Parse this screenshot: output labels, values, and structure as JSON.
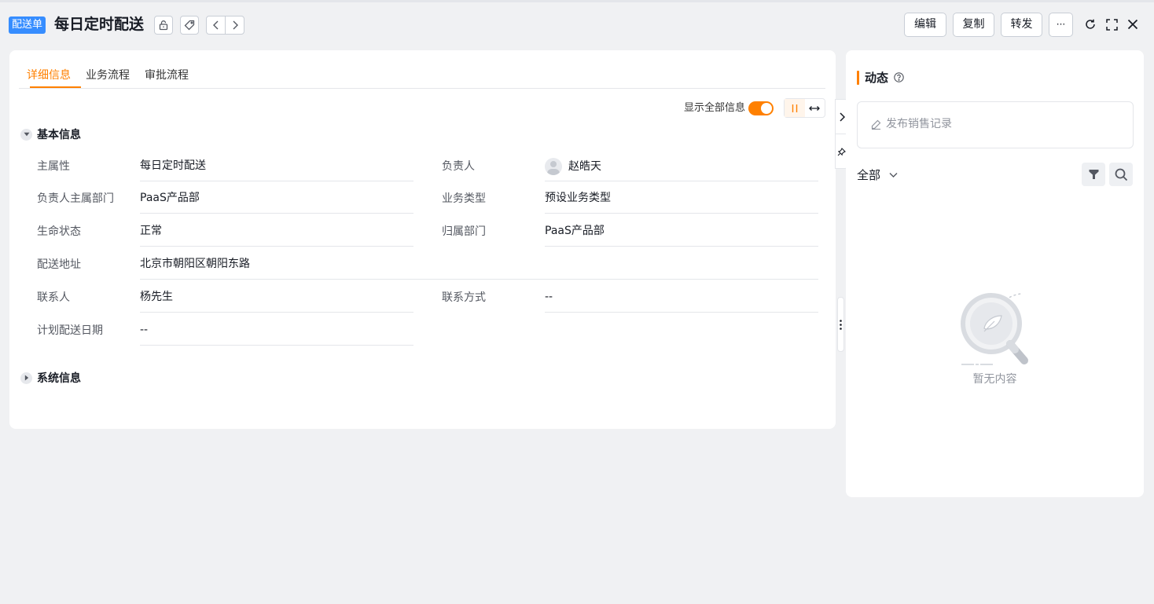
{
  "header": {
    "object_tag": "配送单",
    "title": "每日定时配送",
    "actions": {
      "edit": "编辑",
      "copy": "复制",
      "forward": "转发",
      "more": "···"
    }
  },
  "tabs": [
    {
      "label": "详细信息",
      "active": true
    },
    {
      "label": "业务流程",
      "active": false
    },
    {
      "label": "审批流程",
      "active": false
    }
  ],
  "toolbar": {
    "show_all_label": "显示全部信息",
    "show_all_on": true
  },
  "sections": {
    "basic": {
      "title": "基本信息",
      "expanded": true
    },
    "system": {
      "title": "系统信息",
      "expanded": false
    }
  },
  "fields": {
    "main_attr": {
      "label": "主属性",
      "value": "每日定时配送"
    },
    "owner": {
      "label": "负责人",
      "value": "赵皓天"
    },
    "owner_dept": {
      "label": "负责人主属部门",
      "value": "PaaS产品部"
    },
    "biz_type": {
      "label": "业务类型",
      "value": "预设业务类型"
    },
    "life_status": {
      "label": "生命状态",
      "value": "正常"
    },
    "belong_dept": {
      "label": "归属部门",
      "value": "PaaS产品部"
    },
    "address": {
      "label": "配送地址",
      "value": "北京市朝阳区朝阳东路"
    },
    "contact": {
      "label": "联系人",
      "value": "杨先生"
    },
    "contact_method": {
      "label": "联系方式",
      "value": "--"
    },
    "plan_date": {
      "label": "计划配送日期",
      "value": "--"
    }
  },
  "dynamics": {
    "title": "动态",
    "post_placeholder": "发布销售记录",
    "filter_label": "全部",
    "empty_text": "暂无内容"
  },
  "colors": {
    "accent": "#ff8000",
    "tag_blue": "#368dff"
  }
}
